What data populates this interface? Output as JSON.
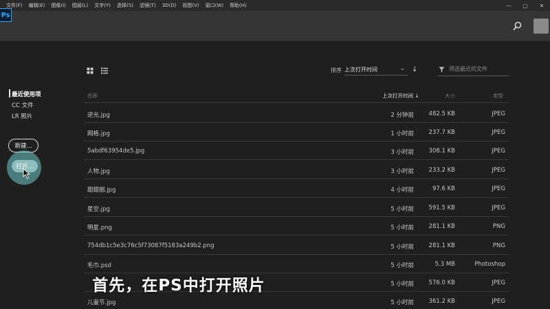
{
  "menu": [
    "文件(F)",
    "编辑(E)",
    "图像(I)",
    "图层(L)",
    "文字(Y)",
    "选择(S)",
    "滤镜(T)",
    "3D(D)",
    "视图(V)",
    "窗口(W)",
    "帮助(H)"
  ],
  "window_controls": {
    "minimize": "—",
    "maximize": "▢",
    "close": "✕"
  },
  "app": {
    "logo": "Ps"
  },
  "sidebar": {
    "items": [
      {
        "label": "最近使用项",
        "active": true
      },
      {
        "label": "CC 文件",
        "active": false
      },
      {
        "label": "LR 照片",
        "active": false
      }
    ],
    "new_button": "新建...",
    "open_button": "打开..."
  },
  "toolbar": {
    "sort_label": "排序",
    "sort_value": "上次打开时间",
    "filter_placeholder": "筛选最近的文件"
  },
  "table": {
    "headers": {
      "name": "名称",
      "time": "上次打开时间",
      "size": "大小",
      "type": "类型"
    },
    "rows": [
      {
        "name": "逆光.jpg",
        "time": "2 分钟前",
        "size": "482.5 KB",
        "type": "JPEG"
      },
      {
        "name": "网格.jpg",
        "time": "1 小时前",
        "size": "237.7 KB",
        "type": "JPEG"
      },
      {
        "name": "5abdf63954de5.jpg",
        "time": "3 小时前",
        "size": "308.1 KB",
        "type": "JPEG"
      },
      {
        "name": "人物.jpg",
        "time": "3 小时前",
        "size": "233.2 KB",
        "type": "JPEG"
      },
      {
        "name": "甜甜圈.jpg",
        "time": "4 小时前",
        "size": "97.6 KB",
        "type": "JPEG"
      },
      {
        "name": "星空.jpg",
        "time": "5 小时前",
        "size": "591.5 KB",
        "type": "JPEG"
      },
      {
        "name": "明星.png",
        "time": "5 小时前",
        "size": "281.1 KB",
        "type": "PNG"
      },
      {
        "name": "754db1c5e3c76c5f73087f5183a249b2.png",
        "time": "5 小时前",
        "size": "281.1 KB",
        "type": "PNG"
      },
      {
        "name": "毛巾.psd",
        "time": "5 小时前",
        "size": "5.3 MB",
        "type": "Photoshop"
      },
      {
        "name": "",
        "time": "5 小时前",
        "size": "576.0 KB",
        "type": "JPEG"
      },
      {
        "name": "儿童节.jpg",
        "time": "5 小时前",
        "size": "361.2 KB",
        "type": "JPEG"
      }
    ]
  },
  "caption": "首先，在PS中打开照片",
  "colors": {
    "background": "#1f1f1f",
    "appbar": "#353535",
    "ps_blue": "#31a8ff",
    "highlight": "#6ec8c8"
  },
  "icons": [
    "grid-view-icon",
    "list-view-icon",
    "sort-descending-icon",
    "filter-icon",
    "search-icon",
    "cursor-icon"
  ]
}
